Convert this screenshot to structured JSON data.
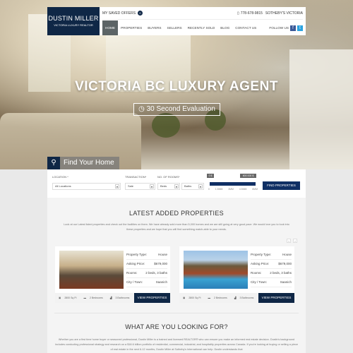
{
  "header": {
    "logo_name": "DUSTIN MILLER",
    "logo_sub": "VICTORIA LUXURY REALTOR",
    "saved_offers": "MY SAVED OFFERS",
    "saved_count": "0",
    "phone": "778-678-9815",
    "brokerage": "SOTHEBY'S VICTORIA",
    "follow": "FOLLOW US",
    "facebook": "f",
    "twitter": "t",
    "nav": [
      "HOME",
      "PROPERTIES",
      "BUYERS",
      "SELLERS",
      "RECENTLY SOLD",
      "BLOG",
      "CONTACT US"
    ]
  },
  "hero": {
    "title": "VICTORIA BC LUXURY AGENT",
    "eval_button": "30 Second Evaluation",
    "search_tab": "Find Your Home"
  },
  "filter": {
    "location_label": "LOCATION *",
    "location_value": "All Locations",
    "transaction_label": "TRANSACTION*",
    "transaction_value": "Sale",
    "rooms_label": "NO. OF ROOMS*",
    "beds_value": "Beds",
    "baths_value": "Baths",
    "price_min": "0 $",
    "price_max": "600 000 $",
    "price_ticks": [
      "0",
      "1.5MM",
      "3MM",
      "4.5MM",
      "6MM"
    ],
    "range_fraction": [
      0,
      1
    ],
    "find_button": "FIND PROPERTIES"
  },
  "latest": {
    "title": "LATEST ADDED PROPERTIES",
    "text": "Look at our Latest listed properties and check out the facilities on them. We have already sold more than 5,000 homes and we are still going at very good pace. We would love you to look into these properties and we hope that you will find something match-able to your needs.",
    "prev": "‹",
    "next": "›",
    "cards": [
      {
        "type_label": "Property Type:",
        "type": "House",
        "price_label": "Asking Price:",
        "price": "$679,000",
        "rooms_label": "Rooms:",
        "rooms": "2 beds, 3 baths",
        "city_label": "City / Town:",
        "city": "Saanich",
        "sqft": "2800 Sq Ft",
        "beds": "2 Bedrooms",
        "baths": "3 Bathrooms",
        "button": "VIEW PROPERTIES"
      },
      {
        "type_label": "Property Type:",
        "type": "House",
        "price_label": "Asking Price:",
        "price": "$679,000",
        "rooms_label": "Rooms:",
        "rooms": "2 beds, 3 baths",
        "city_label": "City / Town:",
        "city": "Saanich",
        "sqft": "2800 Sq Ft",
        "beds": "2 Bedrooms",
        "baths": "3 Bathrooms",
        "button": "VIEW PROPERTIES"
      }
    ]
  },
  "looking": {
    "title": "WHAT ARE YOU LOOKING FOR?",
    "text": "Whether you are a first time home buyer or seasoned professional, Dustin Miller is a trained and licensed REALTOR® who can ensure you make an informed real estate decision. Dustin's background includes conducting professional strategy and research on a $18.6 billion portfolio of residential, commercial, industrial, and hospitality properties across Canada. If you're looking at buying or selling a piece of real estate in the next 6-12 months, Dustin Miller at Sotheby's International can help. Dustin understands that"
  }
}
